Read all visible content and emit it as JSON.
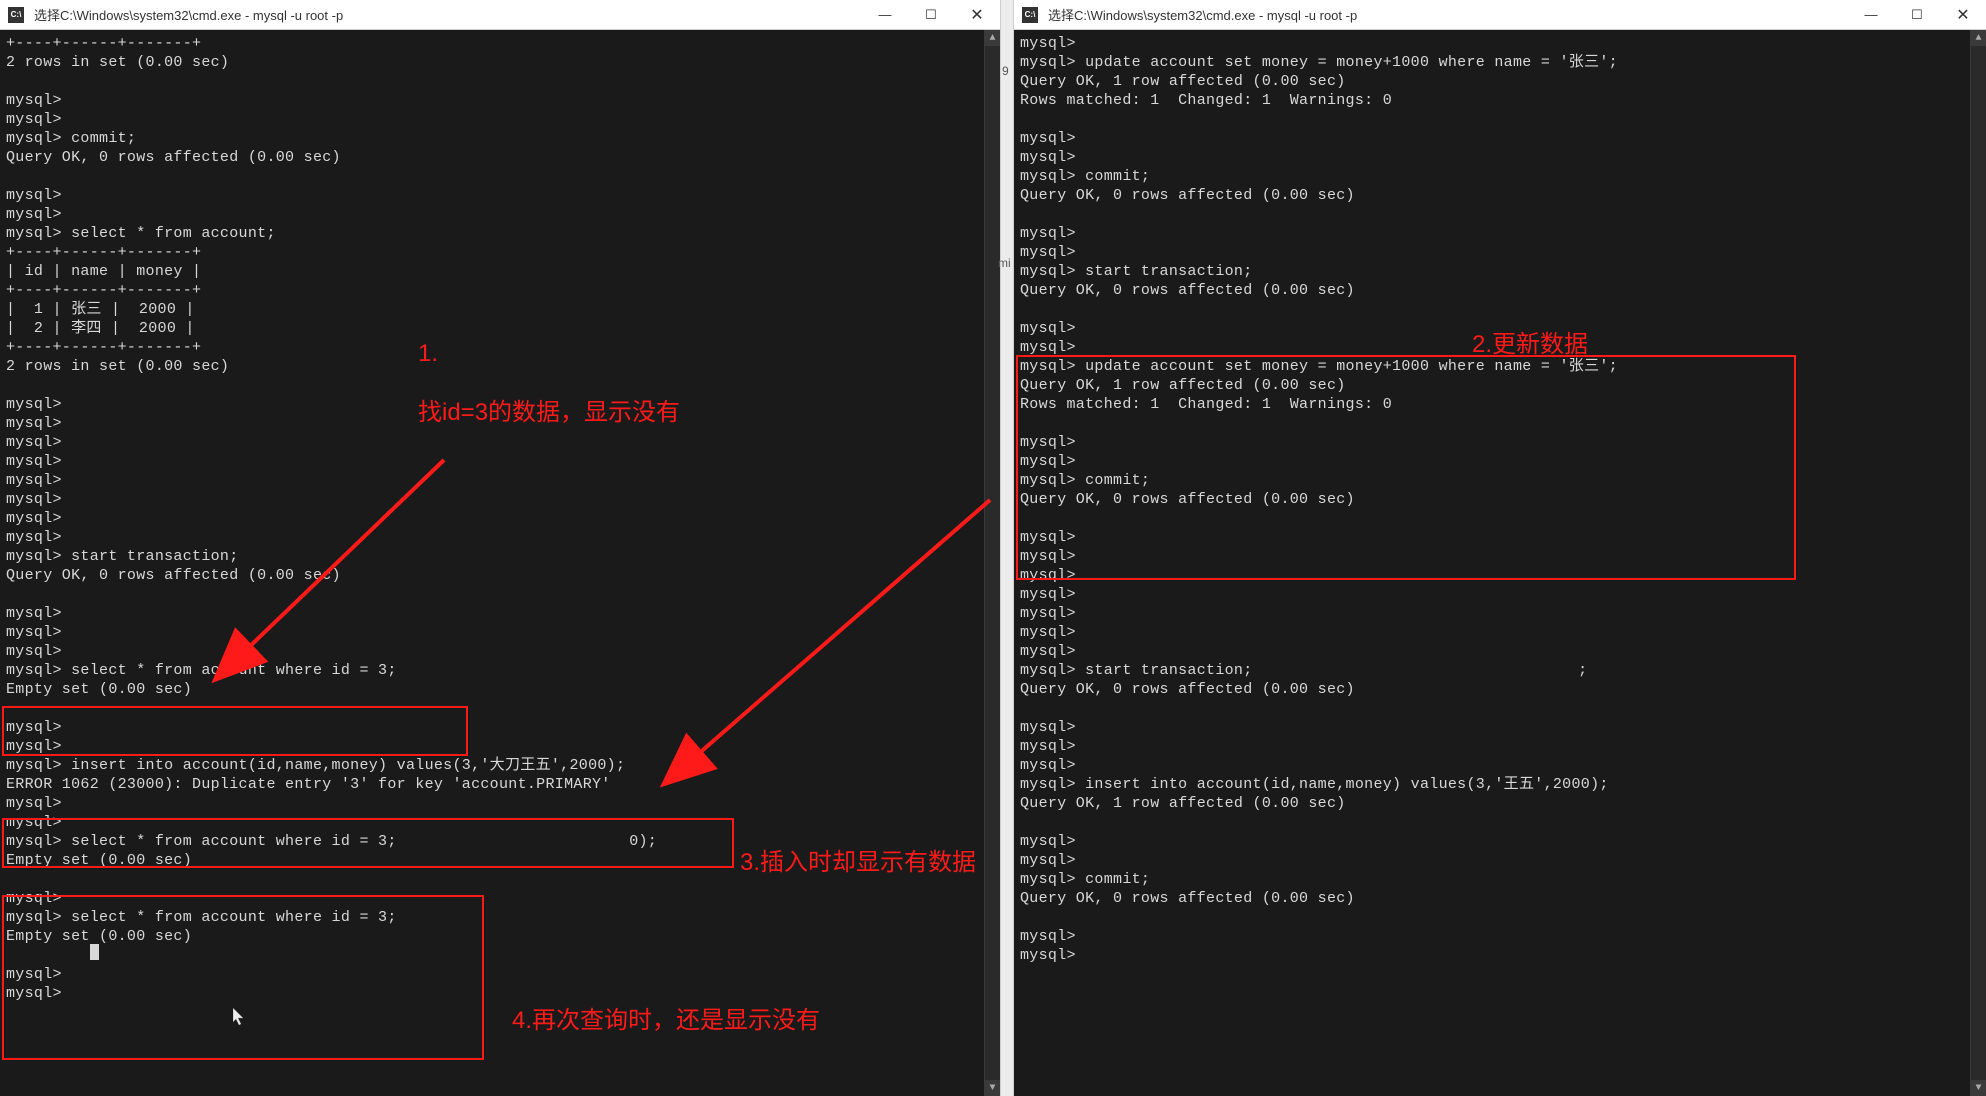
{
  "left": {
    "title": "选择C:\\Windows\\system32\\cmd.exe - mysql  -u root -p",
    "lines": [
      "+----+------+-------+",
      "2 rows in set (0.00 sec)",
      "",
      "mysql>",
      "mysql>",
      "mysql> commit;",
      "Query OK, 0 rows affected (0.00 sec)",
      "",
      "mysql>",
      "mysql>",
      "mysql> select * from account;",
      "+----+------+-------+",
      "| id | name | money |",
      "+----+------+-------+",
      "|  1 | 张三 |  2000 |",
      "|  2 | 李四 |  2000 |",
      "+----+------+-------+",
      "2 rows in set (0.00 sec)",
      "",
      "mysql>",
      "mysql>",
      "mysql>",
      "mysql>",
      "mysql>",
      "mysql>",
      "mysql>",
      "mysql>",
      "mysql> start transaction;",
      "Query OK, 0 rows affected (0.00 sec)",
      "",
      "mysql>",
      "mysql>",
      "mysql>",
      "mysql> select * from account where id = 3;",
      "Empty set (0.00 sec)",
      "",
      "mysql>",
      "mysql>",
      "mysql> insert into account(id,name,money) values(3,'大刀王五',2000);",
      "ERROR 1062 (23000): Duplicate entry '3' for key 'account.PRIMARY'",
      "mysql>",
      "mysql>",
      "mysql> select * from account where id = 3;                         0);",
      "Empty set (0.00 sec)",
      "",
      "mysql>",
      "mysql> select * from account where id = 3;",
      "Empty set (0.00 sec)",
      "",
      "mysql>",
      "mysql>"
    ]
  },
  "right": {
    "title": "选择C:\\Windows\\system32\\cmd.exe - mysql  -u root -p",
    "lines": [
      "mysql>",
      "mysql> update account set money = money+1000 where name = '张三';",
      "Query OK, 1 row affected (0.00 sec)",
      "Rows matched: 1  Changed: 1  Warnings: 0",
      "",
      "mysql>",
      "mysql>",
      "mysql> commit;",
      "Query OK, 0 rows affected (0.00 sec)",
      "",
      "mysql>",
      "mysql>",
      "mysql> start transaction;",
      "Query OK, 0 rows affected (0.00 sec)",
      "",
      "mysql>",
      "mysql>",
      "mysql> update account set money = money+1000 where name = '张三';",
      "Query OK, 1 row affected (0.00 sec)",
      "Rows matched: 1  Changed: 1  Warnings: 0",
      "",
      "mysql>",
      "mysql>",
      "mysql> commit;",
      "Query OK, 0 rows affected (0.00 sec)",
      "",
      "mysql>",
      "mysql>",
      "mysql>",
      "mysql>",
      "mysql>",
      "mysql>",
      "mysql>",
      "mysql> start transaction;                                   ;",
      "Query OK, 0 rows affected (0.00 sec)",
      "",
      "mysql>",
      "mysql>",
      "mysql>",
      "mysql> insert into account(id,name,money) values(3,'王五',2000);",
      "Query OK, 1 row affected (0.00 sec)",
      "",
      "mysql>",
      "mysql>",
      "mysql> commit;",
      "Query OK, 0 rows affected (0.00 sec)",
      "",
      "mysql>",
      "mysql>"
    ]
  },
  "annot": {
    "a1_num": "1.",
    "a1": "找id=3的数据，显示没有",
    "a2": "2.更新数据",
    "a3": "3.插入时却显示有数据",
    "a4": "4.再次查询时，还是显示没有"
  },
  "splitter": {
    "m1": "9",
    "m2": "mi"
  },
  "win": {
    "min": "—",
    "max": "☐",
    "close": "✕"
  },
  "icon": "C:\\"
}
